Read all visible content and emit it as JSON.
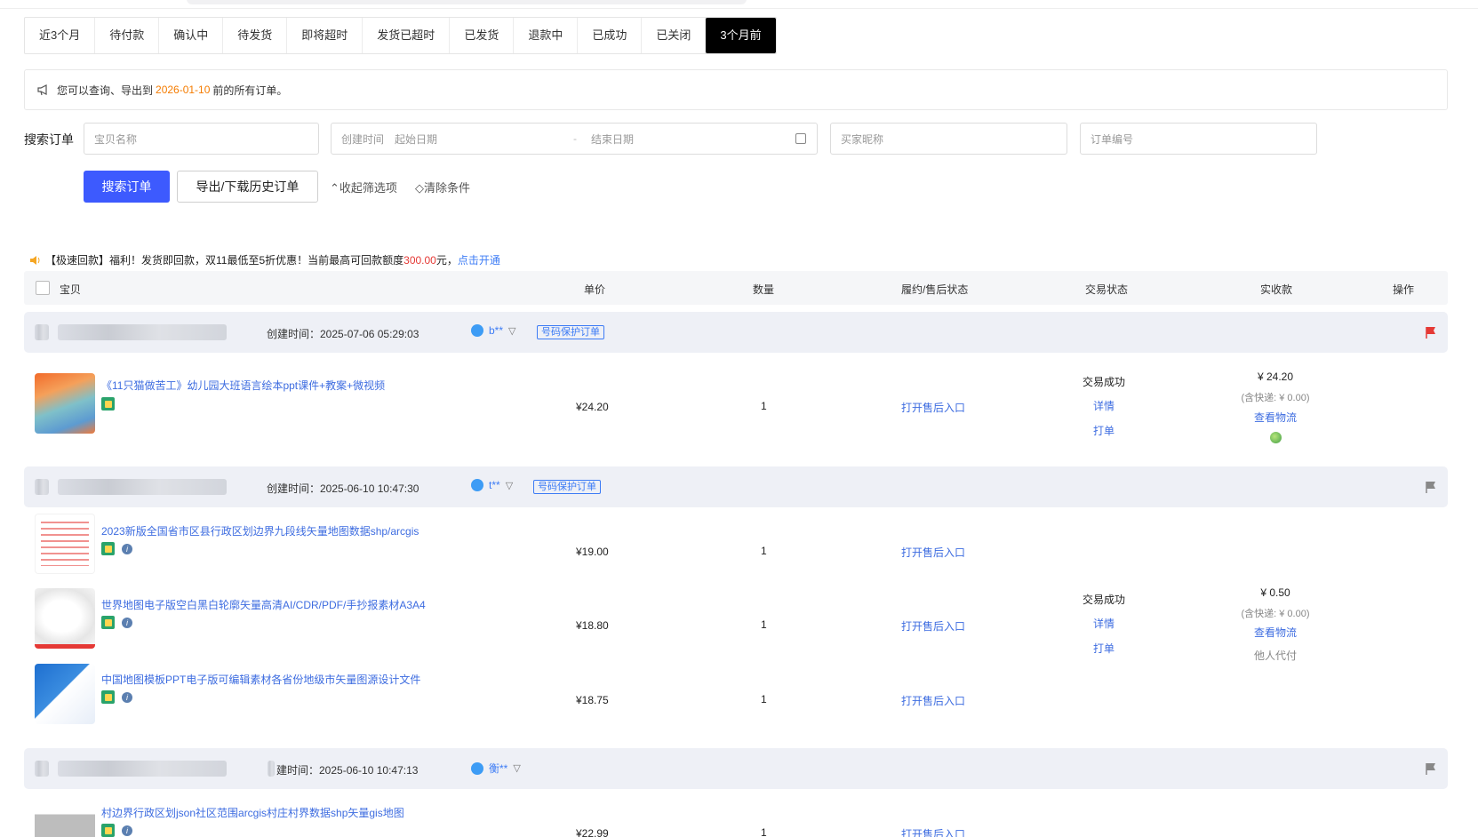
{
  "tabs": [
    {
      "label": "近3个月",
      "active": false
    },
    {
      "label": "待付款",
      "active": false
    },
    {
      "label": "确认中",
      "active": false
    },
    {
      "label": "待发货",
      "active": false
    },
    {
      "label": "即将超时",
      "active": false
    },
    {
      "label": "发货已超时",
      "active": false
    },
    {
      "label": "已发货",
      "active": false
    },
    {
      "label": "退款中",
      "active": false
    },
    {
      "label": "已成功",
      "active": false
    },
    {
      "label": "已关闭",
      "active": false
    },
    {
      "label": "3个月前",
      "active": true
    }
  ],
  "notice": {
    "prefix": "您可以查询、导出到",
    "date": "2026-01-10",
    "suffix": "前的所有订单。"
  },
  "search": {
    "label": "搜索订单",
    "item_placeholder": "宝贝名称",
    "created_label": "创建时间",
    "start_placeholder": "起始日期",
    "separator": "-",
    "end_placeholder": "结束日期",
    "buyer_placeholder": "买家昵称",
    "order_placeholder": "订单编号",
    "search_button": "搜索订单",
    "export_button": "导出/下载历史订单",
    "collapse_link": "收起筛选项",
    "clear_link": "清除条件"
  },
  "promo": {
    "text": "【极速回款】福利！发货即回款，双11最低至5折优惠！当前最高可回款额度",
    "amount": "300.00",
    "unit": "元，",
    "open": "点击开通"
  },
  "table_header": {
    "item": "宝贝",
    "price": "单价",
    "qty": "数量",
    "after_sale": "履约/售后状态",
    "trade_status": "交易状态",
    "paid": "实收款",
    "action": "操作"
  },
  "orders": [
    {
      "created": "创建时间：2025-07-06 05:29:03",
      "buyer": "b**",
      "badge": "号码保护订单",
      "flag_color": "#e53935",
      "items": [
        {
          "title": "《11只猫做苦工》幼儿园大班语言绘本ppt课件+教案+微视频",
          "price": "¥24.20",
          "qty": "1",
          "after_sale": "打开售后入口"
        }
      ],
      "status": "交易成功",
      "detail": "详情",
      "print": "打单",
      "paid": "¥ 24.20",
      "shipping": "(含快递: ¥ 0.00)",
      "logistics": "查看物流"
    },
    {
      "created": "创建时间：2025-06-10 10:47:30",
      "buyer": "t**",
      "badge": "号码保护订单",
      "flag_color": "#888888",
      "items": [
        {
          "title": "2023新版全国省市区县行政区划边界九段线矢量地图数据shp/arcgis",
          "price": "¥19.00",
          "qty": "1",
          "after_sale": "打开售后入口"
        },
        {
          "title": "世界地图电子版空白黑白轮廓矢量高清AI/CDR/PDF/手抄报素材A3A4",
          "price": "¥18.80",
          "qty": "1",
          "after_sale": "打开售后入口"
        },
        {
          "title": "中国地图模板PPT电子版可编辑素材各省份地级市矢量图源设计文件",
          "price": "¥18.75",
          "qty": "1",
          "after_sale": "打开售后入口"
        }
      ],
      "status": "交易成功",
      "detail": "详情",
      "print": "打单",
      "paid": "¥ 0.50",
      "shipping": "(含快递: ¥ 0.00)",
      "logistics": "查看物流",
      "note": "他人代付"
    },
    {
      "created": "建时间：2025-06-10 10:47:13",
      "buyer": "衡**",
      "flag_color": "#888888",
      "items": [
        {
          "title": "村边界行政区划json社区范围arcgis村庄村界数据shp矢量gis地图",
          "price": "¥22.99",
          "qty": "1",
          "after_sale": "打开售后入口"
        }
      ]
    }
  ]
}
